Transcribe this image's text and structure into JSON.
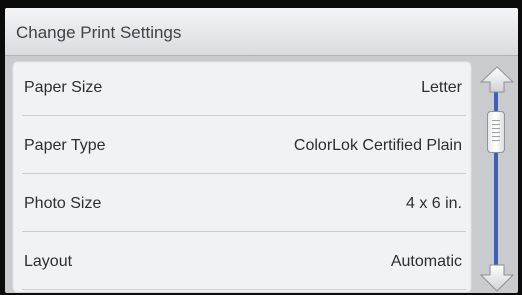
{
  "header": {
    "title": "Change Print Settings"
  },
  "settings": {
    "rows": [
      {
        "label": "Paper Size",
        "value": "Letter"
      },
      {
        "label": "Paper Type",
        "value": "ColorLok Certified Plain"
      },
      {
        "label": "Photo Size",
        "value": "4 x 6 in."
      },
      {
        "label": "Layout",
        "value": "Automatic"
      }
    ]
  },
  "scrollbar": {
    "up_icon": "arrow-up-icon",
    "down_icon": "arrow-down-icon",
    "accent": "#3a5fb4"
  }
}
